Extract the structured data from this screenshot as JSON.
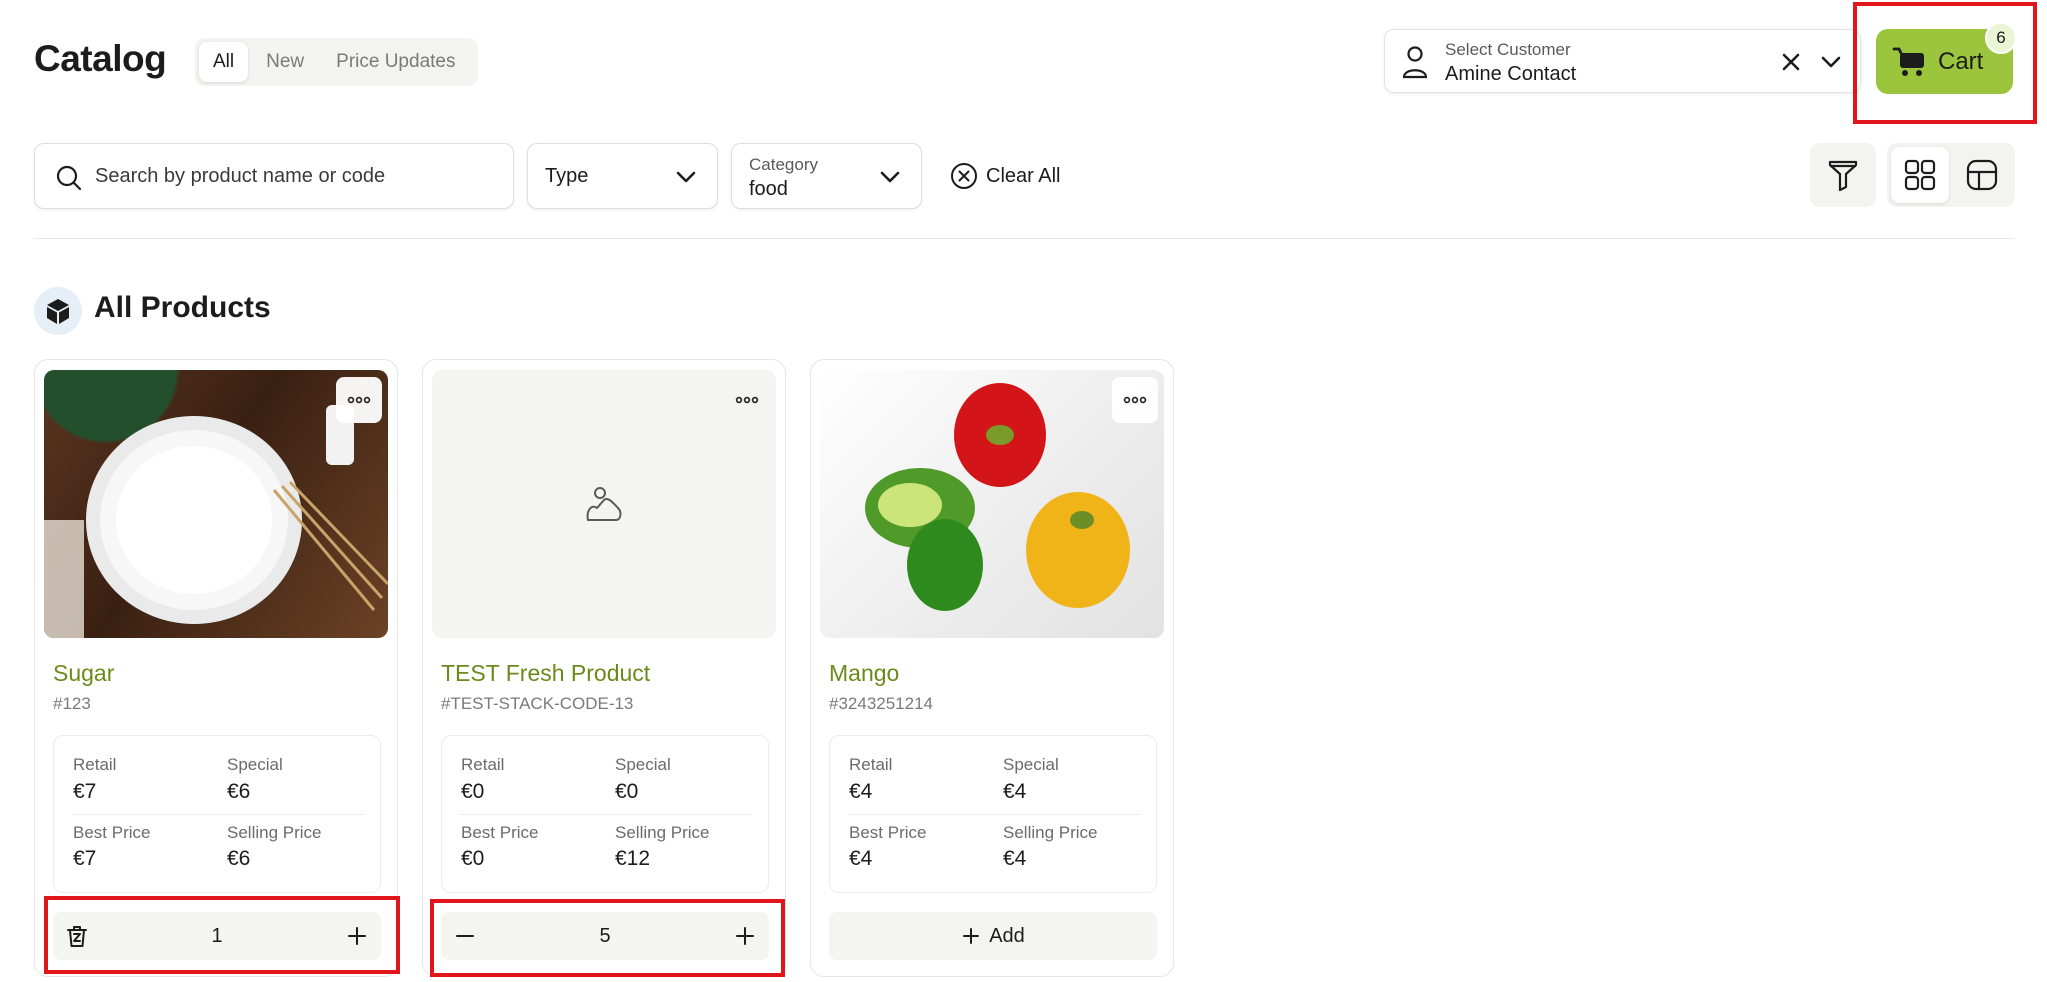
{
  "header": {
    "title": "Catalog",
    "tabs": [
      {
        "label": "All",
        "active": true
      },
      {
        "label": "New",
        "active": false
      },
      {
        "label": "Price Updates",
        "active": false
      }
    ],
    "customer": {
      "label": "Select Customer",
      "value": "Amine Contact"
    },
    "cart": {
      "label": "Cart",
      "count": "6",
      "color": "#9bc53d"
    }
  },
  "filters": {
    "search_placeholder": "Search by product name or code",
    "type_label": "Type",
    "category_label": "Category",
    "category_value": "food",
    "clear_all": "Clear All",
    "view_mode": "grid"
  },
  "section": {
    "title": "All Products"
  },
  "products": [
    {
      "name": "Sugar",
      "code": "#123",
      "image": "sugar-bowl-photo",
      "retail_label": "Retail",
      "retail": "€7",
      "special_label": "Special",
      "special": "€6",
      "best_label": "Best Price",
      "best": "€7",
      "selling_label": "Selling Price",
      "selling": "€6",
      "quantity": "1"
    },
    {
      "name": "TEST Fresh Product",
      "code": "#TEST-STACK-CODE-13",
      "image": "image-placeholder-icon",
      "retail_label": "Retail",
      "retail": "€0",
      "special_label": "Special",
      "special": "€0",
      "best_label": "Best Price",
      "best": "€0",
      "selling_label": "Selling Price",
      "selling": "€12",
      "quantity": "5"
    },
    {
      "name": "Mango",
      "code": "#3243251214",
      "image": "bell-peppers-photo",
      "retail_label": "Retail",
      "retail": "€4",
      "special_label": "Special",
      "special": "€4",
      "best_label": "Best Price",
      "best": "€4",
      "selling_label": "Selling Price",
      "selling": "€4",
      "add_label": "Add"
    }
  ],
  "colors": {
    "accent": "#9bc53d",
    "product_name": "#6b8a1a",
    "highlight": "#e0161b"
  }
}
